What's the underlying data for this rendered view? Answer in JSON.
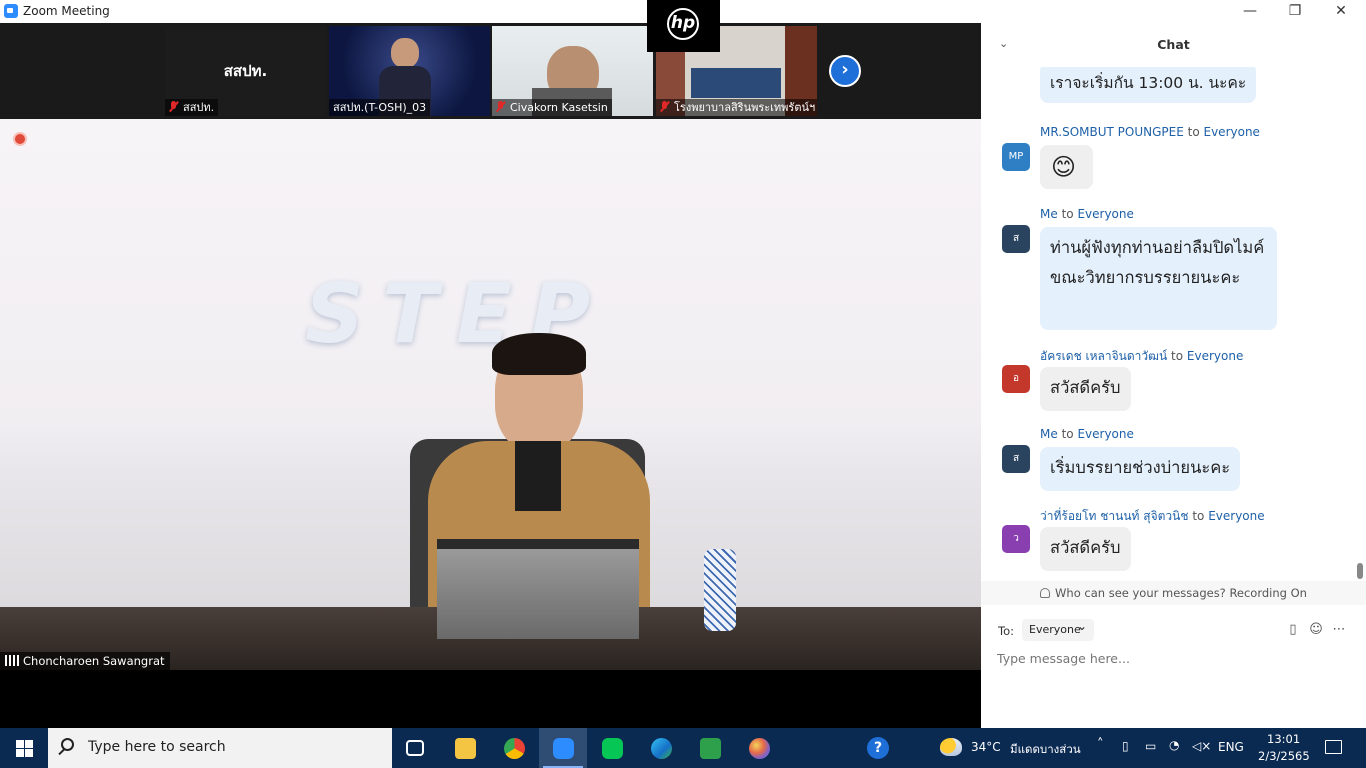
{
  "window": {
    "title": "Zoom Meeting",
    "minimize": "—",
    "restore": "❐",
    "close": "✕"
  },
  "thumbnails": [
    {
      "name": "สสปท.",
      "display_text": "สสปท.",
      "muted": true
    },
    {
      "name": "สสปท.(T-OSH)_03",
      "muted": false
    },
    {
      "name": "Civakorn Kasetsin",
      "muted": true
    },
    {
      "name": "โรงพยาบาลสิรินพระเทพรัตน์ฯ",
      "muted": true
    }
  ],
  "next_button": "›",
  "hp_logo": "hp",
  "speaker": {
    "name": "Choncharoen Sawangrat",
    "backdrop_text": "STEP"
  },
  "chat": {
    "title": "Chat",
    "collapse": "⌄",
    "messages": [
      {
        "sender": "",
        "to": "",
        "text": "เราจะเริ่มกัน 13:00 น. นะคะ",
        "avatar": "",
        "avatar_color": "",
        "style": "blue"
      },
      {
        "sender": "MR.SOMBUT POUNGPEE",
        "to": "to",
        "target": "Everyone",
        "text": "😊",
        "avatar": "MP",
        "avatar_color": "#2e7fc4",
        "style": "grey"
      },
      {
        "sender": "Me",
        "to": "to",
        "target": "Everyone",
        "text": "ท่านผู้ฟังทุกท่านอย่าลืมปิดไมค์ขณะวิทยากรบรรยายนะคะ",
        "avatar": "ส",
        "avatar_color": "#2a4460",
        "style": "blue"
      },
      {
        "sender": "อัครเดช เหลาจินดาวัฒน์",
        "to": "to",
        "target": "Everyone",
        "text": "สวัสดีครับ",
        "avatar": "อ",
        "avatar_color": "#c4382c",
        "style": "grey"
      },
      {
        "sender": "Me",
        "to": "to",
        "target": "Everyone",
        "text": "เริ่มบรรยายช่วงบ่ายนะคะ",
        "avatar": "ส",
        "avatar_color": "#2a4460",
        "style": "blue"
      },
      {
        "sender": "ว่าที่ร้อยโท ชานนท์ สุจิตวนิช",
        "to": "to",
        "target": "Everyone",
        "text": "สวัสดีครับ",
        "avatar": "ว",
        "avatar_color": "#8a3fb0",
        "style": "grey"
      }
    ],
    "who_can_see": "Who can see your messages? Recording On",
    "to_label": "To:",
    "to_value": "Everyone",
    "input_placeholder": "Type message here..."
  },
  "taskbar": {
    "search_placeholder": "Type here to search",
    "help": "?",
    "weather_temp": "34°C",
    "weather_desc": "มีแดดบางส่วน",
    "language": "ENG",
    "time": "13:01",
    "date": "2/3/2565",
    "apps": [
      "task-view",
      "file-explorer",
      "chrome",
      "zoom",
      "line",
      "edge",
      "image-viewer",
      "paint"
    ]
  },
  "colors": {
    "zoom_blue": "#2d8cff",
    "bubble_blue": "#e4f0fc",
    "link_blue": "#1e60a8",
    "taskbar": "#0b2a52"
  }
}
